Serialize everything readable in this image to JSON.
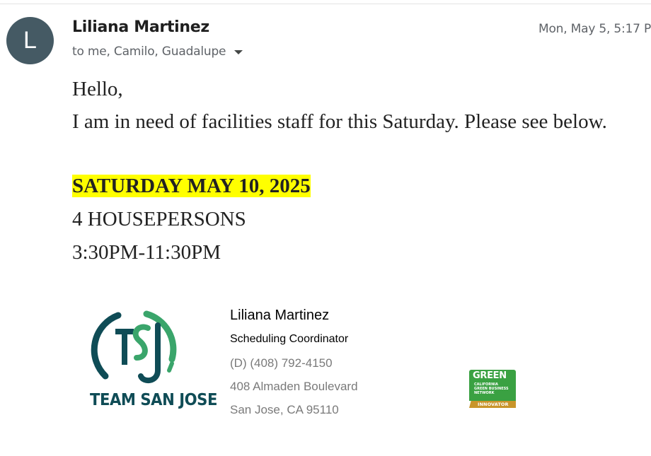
{
  "sender": {
    "avatar_letter": "L",
    "name": "Liliana Martinez",
    "recipients": "to me, Camilo, Guadalupe",
    "timestamp": "Mon, May 5, 5:17 P"
  },
  "message": {
    "greeting": "Hello,",
    "line1": "I am in need of facilities staff for this Saturday. Please see below.",
    "date_line": "SATURDAY MAY 10, 2025",
    "count_line": "4 HOUSEPERSONS",
    "time_line": "3:30PM-11:30PM"
  },
  "signature": {
    "logo_text": "TEAM SAN JOSE",
    "name": "Liliana Martinez",
    "title": "Scheduling Coordinator",
    "phone": "(D) (408) 792-4150",
    "address1": "408 Almaden Boulevard",
    "address2": "San Jose, CA 95110",
    "badge": {
      "word": "GREEN",
      "line1": "CALIFORNIA",
      "line2": "GREEN BUSINESS",
      "line3": "NETWORK",
      "ribbon": "INNOVATOR"
    }
  },
  "colors": {
    "avatar": "#455a64",
    "highlight": "#ffff00",
    "logo_teal": "#0f4c56",
    "logo_green": "#3aa56b",
    "badge_green": "#3aa142",
    "badge_gold": "#c9952b"
  }
}
